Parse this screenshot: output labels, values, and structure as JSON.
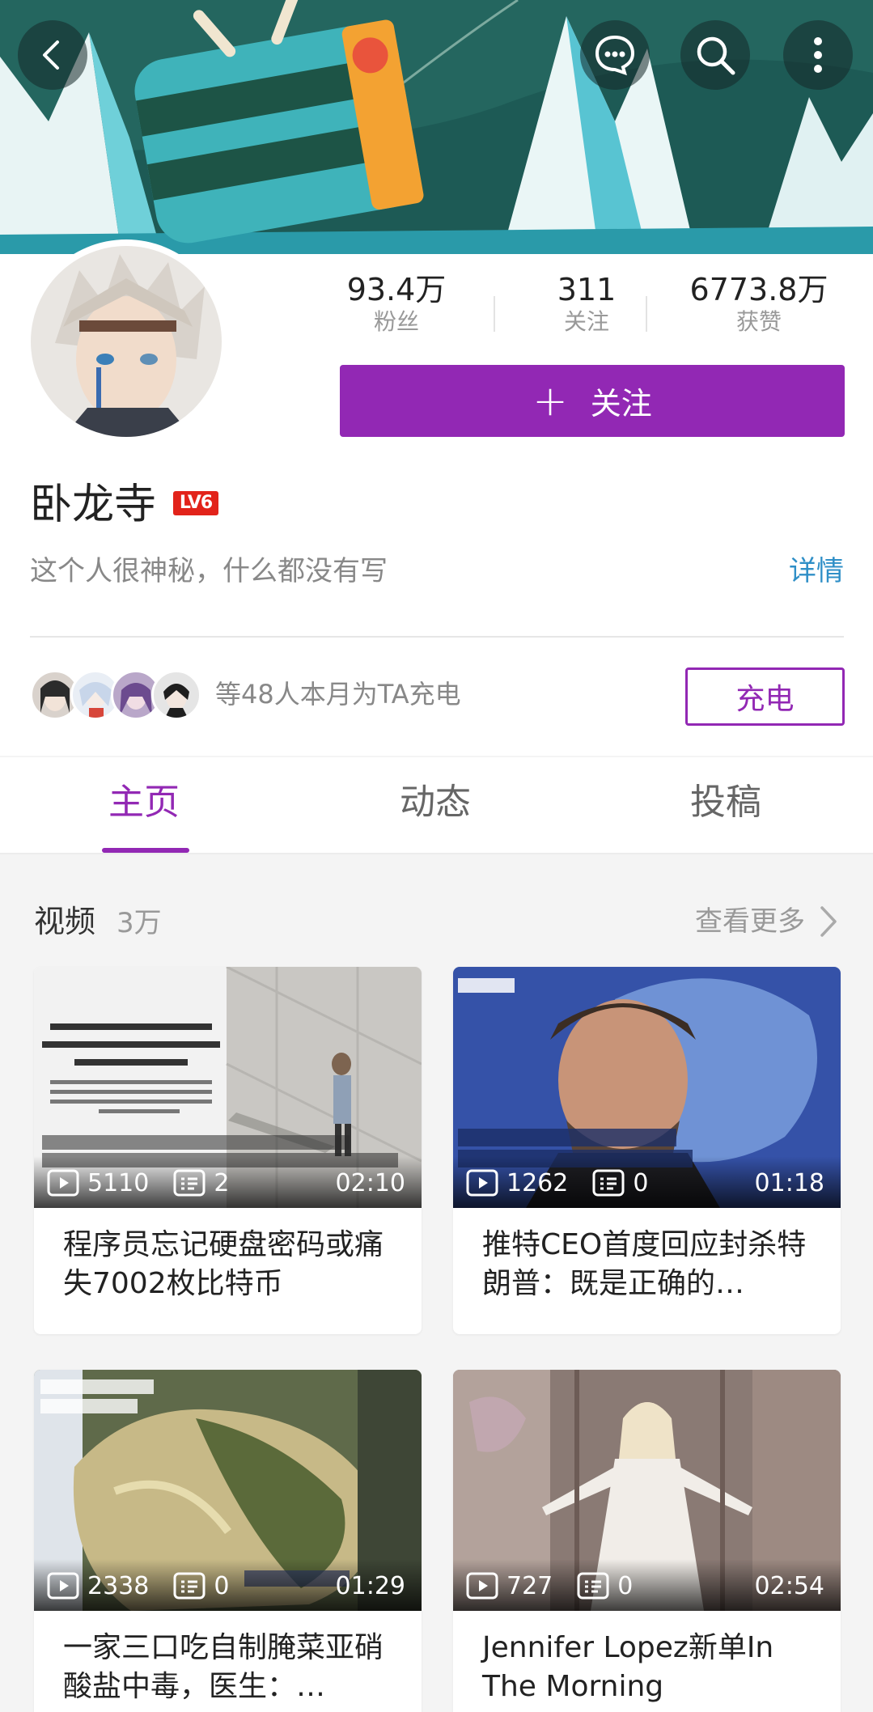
{
  "header": {
    "back_icon": "chevron-left-icon",
    "message_icon": "chat-bubble-icon",
    "search_icon": "search-icon",
    "more_icon": "more-vertical-icon"
  },
  "profile": {
    "username": "卧龙寺",
    "level": "LV6",
    "bio": "这个人很神秘，什么都没有写",
    "detail_link": "详情",
    "stats": [
      {
        "value": "93.4万",
        "label": "粉丝"
      },
      {
        "value": "311",
        "label": "关注"
      },
      {
        "value": "6773.8万",
        "label": "获赞"
      }
    ],
    "follow_button": {
      "icon": "+",
      "label": "关注"
    },
    "supporters_text": "等48人本月为TA充电",
    "charge_button": "充电"
  },
  "tabs": [
    {
      "label": "主页",
      "active": true
    },
    {
      "label": "动态",
      "active": false
    },
    {
      "label": "投稿",
      "active": false
    }
  ],
  "videos_section": {
    "title": "视频",
    "count": "3万",
    "more": "查看更多",
    "items": [
      {
        "title": "程序员忘记硬盘密码或痛失7002枚比特币",
        "title_display": "程序员忘记硬盘密码或\n痛失7002枚比特币",
        "plays": "5110",
        "danmaku": "2",
        "duration": "02:10"
      },
      {
        "title": "推特CEO首度回应封杀特朗普：既是正确的…",
        "title_display": "推特CEO首度回应封杀\n特朗普：既是正确的…",
        "plays": "1262",
        "danmaku": "0",
        "duration": "01:18"
      },
      {
        "title": "一家三口吃自制腌菜亚硝酸盐中毒，医生：…",
        "title_display": "一家三口吃自制腌菜亚\n硝酸盐中毒，医生：…",
        "plays": "2338",
        "danmaku": "0",
        "duration": "01:29"
      },
      {
        "title": "Jennifer Lopez新单In The Morning",
        "title_display": "Jennifer Lopez新单In\nThe Morning",
        "plays": "727",
        "danmaku": "0",
        "duration": "02:54"
      }
    ]
  },
  "colors": {
    "accent": "#9228b4",
    "link": "#2f8fc7",
    "level_badge": "#e2231a"
  }
}
